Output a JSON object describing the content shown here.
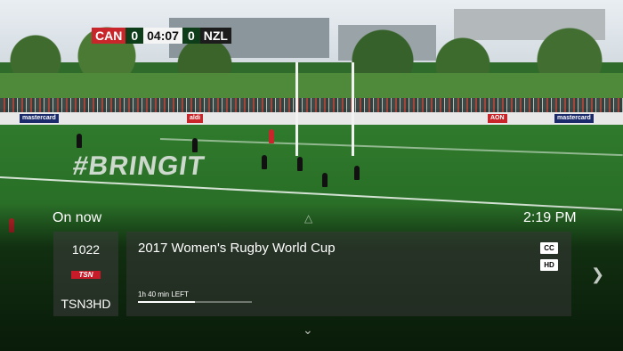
{
  "score_bug": {
    "team_a": "CAN",
    "score_a": "0",
    "clock": "04:07",
    "score_b": "0",
    "team_b": "NZL"
  },
  "field_text": "#BRINGIT",
  "overlay": {
    "section_label": "On now",
    "current_time": "2:19 PM",
    "channel": {
      "number": "1022",
      "logo_text": "TSN",
      "name": "TSN3HD"
    },
    "program": {
      "title": "2017 Women's Rugby World Cup",
      "badges": [
        "CC",
        "HD"
      ],
      "time_left": "1h 40 min LEFT",
      "progress_fraction": 0.5
    }
  },
  "icons": [
    "chevron-up-icon",
    "chevron-down-icon",
    "chevron-right-icon"
  ]
}
